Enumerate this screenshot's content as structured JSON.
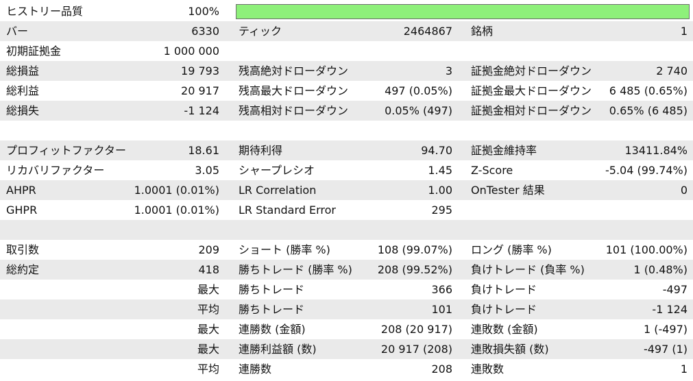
{
  "history_quality": {
    "label": "ヒストリー品質",
    "value": "100%",
    "fraction": 1.0,
    "bar_color": "#8ef07a"
  },
  "rows": {
    "r1": {
      "c1": "バー",
      "c2": "6330",
      "c3": "ティック",
      "c4": "2464867",
      "c5": "銘柄",
      "c6": "1"
    },
    "r2": {
      "c1": "初期証拠金",
      "c2": "1 000 000",
      "c3": "",
      "c4": "",
      "c5": "",
      "c6": ""
    },
    "r3": {
      "c1": "総損益",
      "c2": "19 793",
      "c3": "残高絶対ドローダウン",
      "c4": "3",
      "c5": "証拠金絶対ドローダウン",
      "c6": "2 740"
    },
    "r4": {
      "c1": "総利益",
      "c2": "20 917",
      "c3": "残高最大ドローダウン",
      "c4": "497 (0.05%)",
      "c5": "証拠金最大ドローダウン",
      "c6": "6 485 (0.65%)"
    },
    "r5": {
      "c1": "総損失",
      "c2": "-1 124",
      "c3": "残高相対ドローダウン",
      "c4": "0.05% (497)",
      "c5": "証拠金相対ドローダウン",
      "c6": "0.65% (6 485)"
    },
    "r7": {
      "c1": "プロフィットファクター",
      "c2": "18.61",
      "c3": "期待利得",
      "c4": "94.70",
      "c5": "証拠金維持率",
      "c6": "13411.84%"
    },
    "r8": {
      "c1": "リカバリファクター",
      "c2": "3.05",
      "c3": "シャープレシオ",
      "c4": "1.45",
      "c5": "Z-Score",
      "c6": "-5.04 (99.74%)"
    },
    "r9": {
      "c1": "AHPR",
      "c2": "1.0001 (0.01%)",
      "c3": "LR Correlation",
      "c4": "1.00",
      "c5": "OnTester 結果",
      "c6": "0"
    },
    "r10": {
      "c1": "GHPR",
      "c2": "1.0001 (0.01%)",
      "c3": "LR Standard Error",
      "c4": "295",
      "c5": "",
      "c6": ""
    },
    "r12": {
      "c1": "取引数",
      "c2": "209",
      "c3": "ショート (勝率 %)",
      "c4": "108 (99.07%)",
      "c5": "ロング (勝率 %)",
      "c6": "101 (100.00%)"
    },
    "r13": {
      "c1": "総約定",
      "c2": "418",
      "c3": "勝ちトレード (勝率 %)",
      "c4": "208 (99.52%)",
      "c5": "負けトレード (負率 %)",
      "c6": "1 (0.48%)"
    },
    "r14": {
      "c1": "",
      "c2": "最大",
      "c3": "勝ちトレード",
      "c4": "366",
      "c5": "負けトレード",
      "c6": "-497"
    },
    "r15": {
      "c1": "",
      "c2": "平均",
      "c3": "勝ちトレード",
      "c4": "101",
      "c5": "負けトレード",
      "c6": "-1 124"
    },
    "r16": {
      "c1": "",
      "c2": "最大",
      "c3": "連勝数 (金額)",
      "c4": "208 (20 917)",
      "c5": "連敗数 (金額)",
      "c6": "1 (-497)"
    },
    "r17": {
      "c1": "",
      "c2": "最大",
      "c3": "連勝利益額 (数)",
      "c4": "20 917 (208)",
      "c5": "連敗損失額 (数)",
      "c6": "-497 (1)"
    },
    "r18": {
      "c1": "",
      "c2": "平均",
      "c3": "連勝数",
      "c4": "208",
      "c5": "連敗数",
      "c6": "1"
    }
  }
}
